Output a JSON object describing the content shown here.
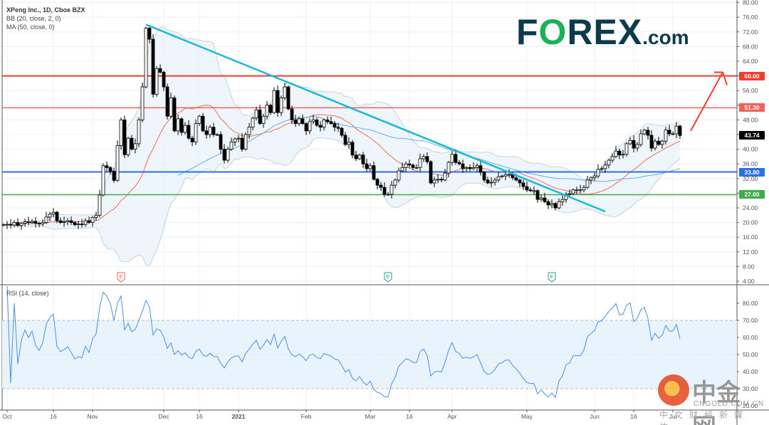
{
  "header": {
    "title": "XPeng Inc., 1D, Cboe BZX",
    "indicator_bb": "BB (20, close, 2, 0)",
    "indicator_ma": "MA (50, close, 0)",
    "rsi_label": "RSI (14, close)"
  },
  "logos": {
    "forex": "FOREX.com",
    "forex_main": "F",
    "forex_o": "O",
    "forex_rest": "REX",
    "forex_com": ".com",
    "cngold_cn": "中金网",
    "cngold_en": "CNGOLD.COM.CN",
    "cngold_tag": "中文财经新媒体"
  },
  "colors": {
    "up": "#ffffff",
    "down": "#000000",
    "bb": "#c9d3dd",
    "bb_fill": "#eaf4fb",
    "ma20": "#f26b5b",
    "ma50": "#5aaef0",
    "trend": "#1ab8d8",
    "res60": "#f23c2e",
    "res51": "#f26258",
    "sup33": "#2c6fe8",
    "sup27": "#3fae49",
    "rsi": "#4a90e2",
    "last": "#000000"
  },
  "chart_data": {
    "type": "candlestick",
    "title": "XPeng Inc., 1D, Cboe BZX",
    "ylim": [
      4,
      80
    ],
    "y_ticks": [
      "80.00",
      "76.00",
      "72.00",
      "68.00",
      "64.00",
      "60.00",
      "56.00",
      "52.00",
      "48.00",
      "44.00",
      "40.00",
      "36.00",
      "32.00",
      "28.00",
      "24.00",
      "20.00",
      "16.00",
      "12.00",
      "8.00",
      "4.00"
    ],
    "x_ticks": [
      {
        "label": "Oct",
        "bar": 1
      },
      {
        "label": "16",
        "bar": 14
      },
      {
        "label": "Nov",
        "bar": 25
      },
      {
        "label": "Dec",
        "bar": 45
      },
      {
        "label": "16",
        "bar": 55
      },
      {
        "label": "2021",
        "bar": 66
      },
      {
        "label": "Feb",
        "bar": 85
      },
      {
        "label": "Mar",
        "bar": 103
      },
      {
        "label": "16",
        "bar": 114
      },
      {
        "label": "Apr",
        "bar": 126
      },
      {
        "label": "May",
        "bar": 147
      },
      {
        "label": "Jun",
        "bar": 166
      },
      {
        "label": "16",
        "bar": 177
      },
      {
        "label": "Jul",
        "bar": 188
      }
    ],
    "closes": [
      19.4,
      19.5,
      19.3,
      20,
      19.2,
      19.8,
      20.2,
      20,
      20.3,
      19.8,
      19.6,
      20,
      21.5,
      22.3,
      22.8,
      20.5,
      20,
      20.2,
      20.5,
      20,
      19.4,
      19.6,
      19.5,
      20.5,
      20,
      21.4,
      22,
      27.5,
      35.5,
      35,
      34,
      31.5,
      41,
      48,
      38.5,
      43,
      40,
      41.5,
      48,
      57,
      73,
      70,
      55,
      62,
      61,
      57,
      49,
      54,
      45,
      48.3,
      44.6,
      46.5,
      43,
      42,
      47,
      49,
      45,
      44,
      46,
      44,
      44,
      40,
      37,
      40,
      42,
      42.8,
      43,
      40,
      44,
      46,
      48.5,
      50.7,
      47,
      49,
      52,
      50,
      56,
      50,
      54,
      57,
      51,
      48,
      47,
      48.3,
      47,
      45,
      47.5,
      48,
      46.5,
      46,
      48,
      47.5,
      47,
      46,
      45.7,
      43.8,
      41.3,
      41.9,
      38.4,
      37.4,
      38.4,
      36,
      34.7,
      35.5,
      31.8,
      30.2,
      29.6,
      27.7,
      27.7,
      30.2,
      31.6,
      34.1,
      35,
      36,
      35.7,
      35,
      35,
      37.4,
      38,
      36.6,
      30.8,
      31.6,
      31.8,
      31.6,
      33.5,
      36.4,
      38.6,
      36.4,
      36,
      34.7,
      35,
      34.7,
      35,
      35.5,
      33.7,
      31.6,
      30.8,
      31,
      31.6,
      32.5,
      32.7,
      33.1,
      33.1,
      32.2,
      31.6,
      30.8,
      29.8,
      28.9,
      28.7,
      28.7,
      26.3,
      26.7,
      25.7,
      24.8,
      25.2,
      24,
      25.7,
      26.3,
      27.7,
      27.9,
      28.9,
      28.9,
      28.9,
      29.6,
      31.6,
      32.2,
      32.7,
      34.5,
      34.7,
      35.7,
      37,
      38,
      39.5,
      38.4,
      38.6,
      41.5,
      42.4,
      40.3,
      41.3,
      44.2,
      45.2,
      43.8,
      40.3,
      42.2,
      41.3,
      42.2,
      45.2,
      44.2,
      44.2,
      46.3,
      43.74
    ],
    "levels": [
      {
        "label": "60.00",
        "value": 60,
        "color": "#f23c2e"
      },
      {
        "label": "51.30",
        "value": 51.3,
        "color": "#f26258"
      },
      {
        "label": "33.80",
        "value": 33.8,
        "color": "#2c6fe8"
      },
      {
        "label": "27.60",
        "value": 27.6,
        "color": "#3fae49"
      }
    ],
    "last_price": {
      "label": "43.74",
      "value": 43.74
    },
    "trendline": {
      "from": {
        "bar": 40,
        "price": 74
      },
      "to": {
        "bar": 169,
        "price": 23
      }
    },
    "projection_arrow": {
      "from": {
        "bar": 193,
        "price": 45
      },
      "to": {
        "bar": 202,
        "price": 61
      }
    },
    "earnings": [
      {
        "bar": 33,
        "label": "E",
        "color": "#f26258"
      },
      {
        "bar": 108,
        "label": "E",
        "color": "#2a9d8f"
      },
      {
        "bar": 154,
        "label": "E",
        "color": "#2a9d8f"
      }
    ],
    "rsi": {
      "period": 14,
      "ylim": [
        20,
        85
      ],
      "ticks": [
        "80.00",
        "70.00",
        "60.00",
        "50.00",
        "40.00",
        "30.00",
        "20.00"
      ],
      "upper": 70,
      "lower": 30
    }
  }
}
